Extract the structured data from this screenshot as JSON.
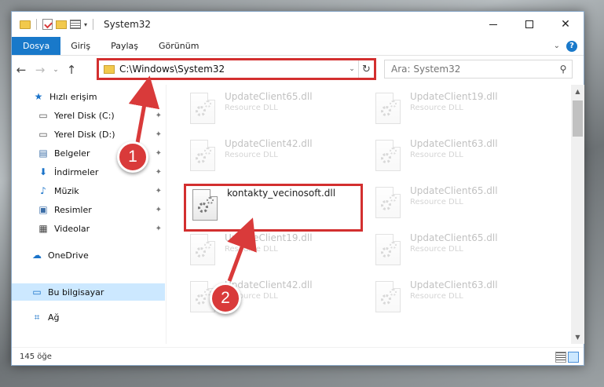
{
  "window": {
    "title": "System32",
    "buttons": {
      "minimize": "–",
      "maximize": "□",
      "close": "✕"
    }
  },
  "ribbon": {
    "tabs": [
      "Dosya",
      "Giriş",
      "Paylaş",
      "Görünüm"
    ],
    "help": "?",
    "expand": "⌄"
  },
  "nav": {
    "back": "←",
    "forward": "→",
    "recent": "⌄",
    "up": "↑"
  },
  "address": {
    "path": "C:\\Windows\\System32",
    "chevron": "⌄",
    "refresh": "↻"
  },
  "search": {
    "placeholder": "Ara: System32",
    "icon": "search-icon"
  },
  "sidebar": {
    "items": [
      {
        "label": "Hızlı erişim",
        "icon": "star-icon",
        "pinned": false
      },
      {
        "label": "Yerel Disk (C:)",
        "icon": "drive-icon",
        "pinned": true
      },
      {
        "label": "Yerel Disk (D:)",
        "icon": "drive-icon",
        "pinned": true
      },
      {
        "label": "Belgeler",
        "icon": "documents-icon",
        "pinned": true
      },
      {
        "label": "İndirmeler",
        "icon": "download-icon",
        "pinned": true
      },
      {
        "label": "Müzik",
        "icon": "music-icon",
        "pinned": true
      },
      {
        "label": "Resimler",
        "icon": "pictures-icon",
        "pinned": true
      },
      {
        "label": "Videolar",
        "icon": "video-icon",
        "pinned": true
      },
      {
        "label": "OneDrive",
        "icon": "cloud-icon",
        "pinned": false
      },
      {
        "label": "Bu bilgisayar",
        "icon": "computer-icon",
        "pinned": false
      },
      {
        "label": "Ağ",
        "icon": "network-icon",
        "pinned": false
      }
    ],
    "pin_glyph": "📌"
  },
  "files": [
    {
      "name": "UpdateClient65.dll",
      "type": "Resource DLL"
    },
    {
      "name": "UpdateClient19.dll",
      "type": "Resource DLL"
    },
    {
      "name": "UpdateClient42.dll",
      "type": "Resource DLL"
    },
    {
      "name": "UpdateClient63.dll",
      "type": "Resource DLL"
    },
    {
      "name": "kontakty_vecinosoft.dll",
      "type": ""
    },
    {
      "name": "UpdateClient65.dll",
      "type": "Resource DLL"
    },
    {
      "name": "UpdateClient19.dll",
      "type": "Resource DLL"
    },
    {
      "name": "UpdateClient65.dll",
      "type": "Resource DLL"
    },
    {
      "name": "UpdateClient42.dll",
      "type": "Resource DLL"
    },
    {
      "name": "UpdateClient63.dll",
      "type": "Resource DLL"
    }
  ],
  "status": {
    "count": "145 öğe"
  },
  "annotations": {
    "step1": "1",
    "step2": "2",
    "highlight_color": "#d32f2f"
  }
}
